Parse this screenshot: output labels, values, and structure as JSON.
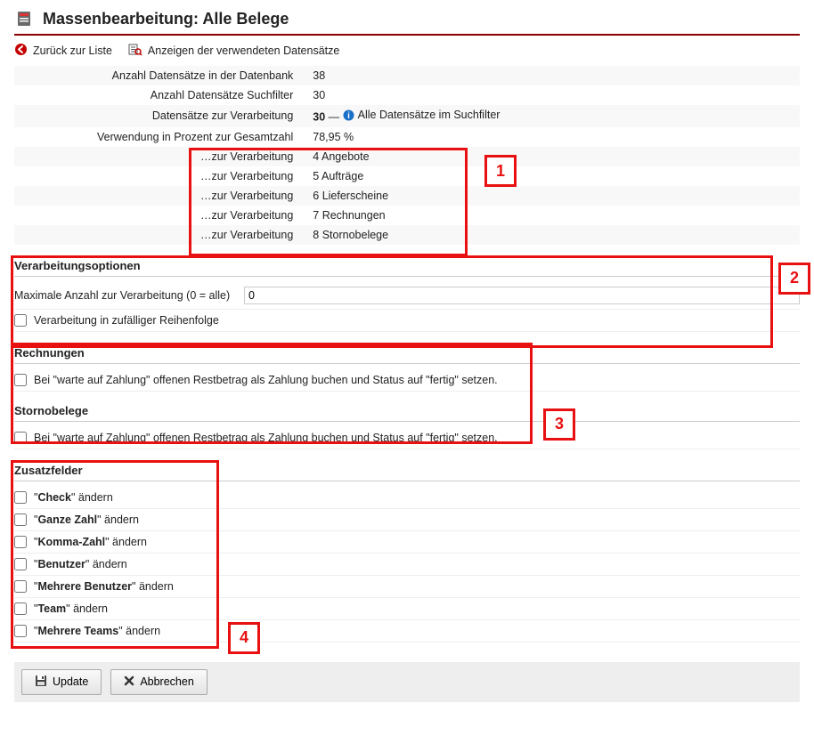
{
  "header": {
    "title": "Massenbearbeitung: Alle Belege"
  },
  "actions": {
    "back": "Zurück zur Liste",
    "showUsed": "Anzeigen der verwendeten Datensätze"
  },
  "info": {
    "rows": [
      {
        "label": "Anzahl Datensätze in der Datenbank",
        "value": "38"
      },
      {
        "label": "Anzahl Datensätze Suchfilter",
        "value": "30"
      },
      {
        "label": "Datensätze zur Verarbeitung",
        "value": "30",
        "note": "Alle Datensätze im Suchfilter"
      },
      {
        "label": "Verwendung in Prozent zur Gesamtzahl",
        "value": "78,95 %"
      }
    ],
    "breakdown": [
      {
        "label": "…zur Verarbeitung",
        "value": "4 Angebote"
      },
      {
        "label": "…zur Verarbeitung",
        "value": "5 Aufträge"
      },
      {
        "label": "…zur Verarbeitung",
        "value": "6 Lieferscheine"
      },
      {
        "label": "…zur Verarbeitung",
        "value": "7 Rechnungen"
      },
      {
        "label": "…zur Verarbeitung",
        "value": "8 Stornobelege"
      }
    ]
  },
  "options": {
    "heading": "Verarbeitungsoptionen",
    "maxLabel": "Maximale Anzahl zur Verarbeitung (0 = alle)",
    "maxValue": "0",
    "randomOrder": "Verarbeitung in zufälliger Reihenfolge"
  },
  "rechnungen": {
    "heading": "Rechnungen",
    "cb": "Bei \"warte auf Zahlung\" offenen Restbetrag als Zahlung buchen und Status auf \"fertig\" setzen."
  },
  "storno": {
    "heading": "Stornobelege",
    "cb": "Bei \"warte auf Zahlung\" offenen Restbetrag als Zahlung buchen und Status auf \"fertig\" setzen."
  },
  "zusatz": {
    "heading": "Zusatzfelder",
    "items": [
      {
        "bold": "Check",
        "rest": " ändern"
      },
      {
        "bold": "Ganze Zahl",
        "rest": " ändern"
      },
      {
        "bold": "Komma-Zahl",
        "rest": " ändern"
      },
      {
        "bold": "Benutzer",
        "rest": " ändern"
      },
      {
        "bold": "Mehrere Benutzer",
        "rest": " ändern"
      },
      {
        "bold": "Team",
        "rest": " ändern"
      },
      {
        "bold": "Mehrere Teams",
        "rest": " ändern"
      }
    ]
  },
  "buttons": {
    "update": "Update",
    "cancel": "Abbrechen"
  },
  "annotations": {
    "l1": "1",
    "l2": "2",
    "l3": "3",
    "l4": "4"
  }
}
